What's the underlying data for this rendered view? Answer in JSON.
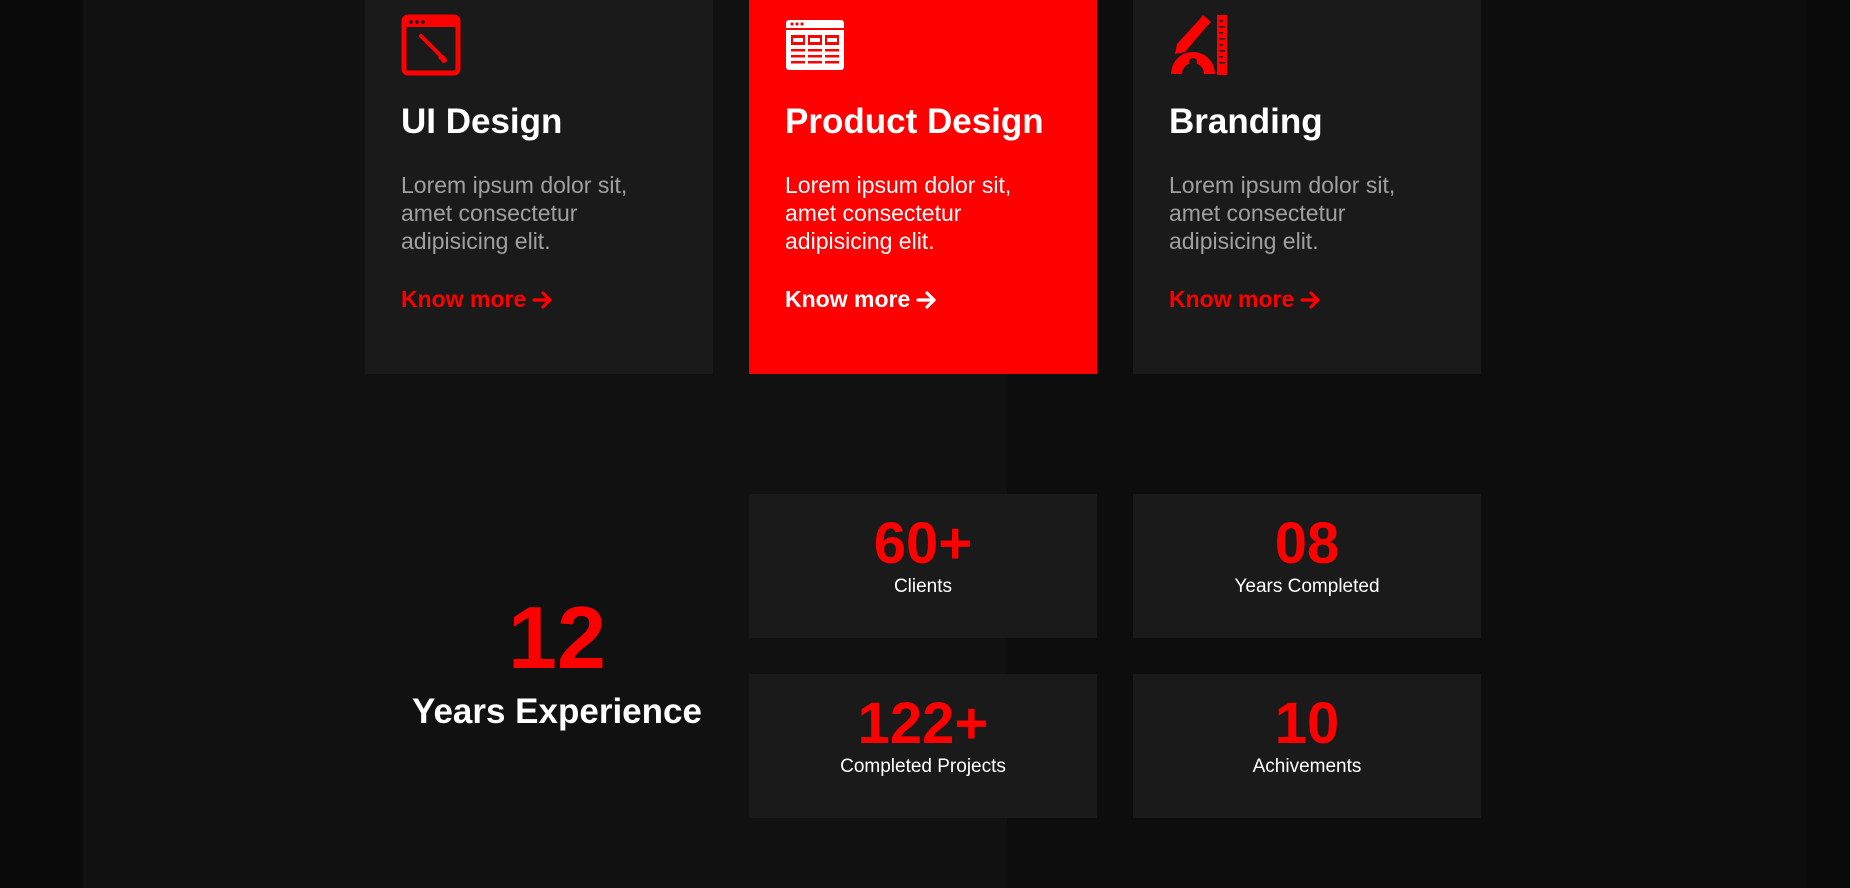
{
  "services": [
    {
      "title": "UI Design",
      "description": "Lorem ipsum dolor sit, amet consectetur adipisicing elit.",
      "link_label": "Know more",
      "icon": "design-tool-icon",
      "active": false
    },
    {
      "title": "Product Design",
      "description": "Lorem ipsum dolor sit, amet consectetur adipisicing elit.",
      "link_label": "Know more",
      "icon": "web-layout-icon",
      "active": true
    },
    {
      "title": "Branding",
      "description": "Lorem ipsum dolor sit, amet consectetur adipisicing elit.",
      "link_label": "Know more",
      "icon": "drafting-tools-icon",
      "active": false
    }
  ],
  "experience": {
    "number": "12",
    "label": "Years Experience"
  },
  "stats": [
    {
      "value": "60+",
      "label": "Clients"
    },
    {
      "value": "08",
      "label": "Years Completed"
    },
    {
      "value": "122+",
      "label": "Completed Projects"
    },
    {
      "value": "10",
      "label": "Achivements"
    }
  ],
  "colors": {
    "accent": "#ff0000",
    "card_bg": "#1a1a1a",
    "page_bg": "#111111",
    "text": "#ffffff",
    "muted_text": "#a0a0a0"
  }
}
